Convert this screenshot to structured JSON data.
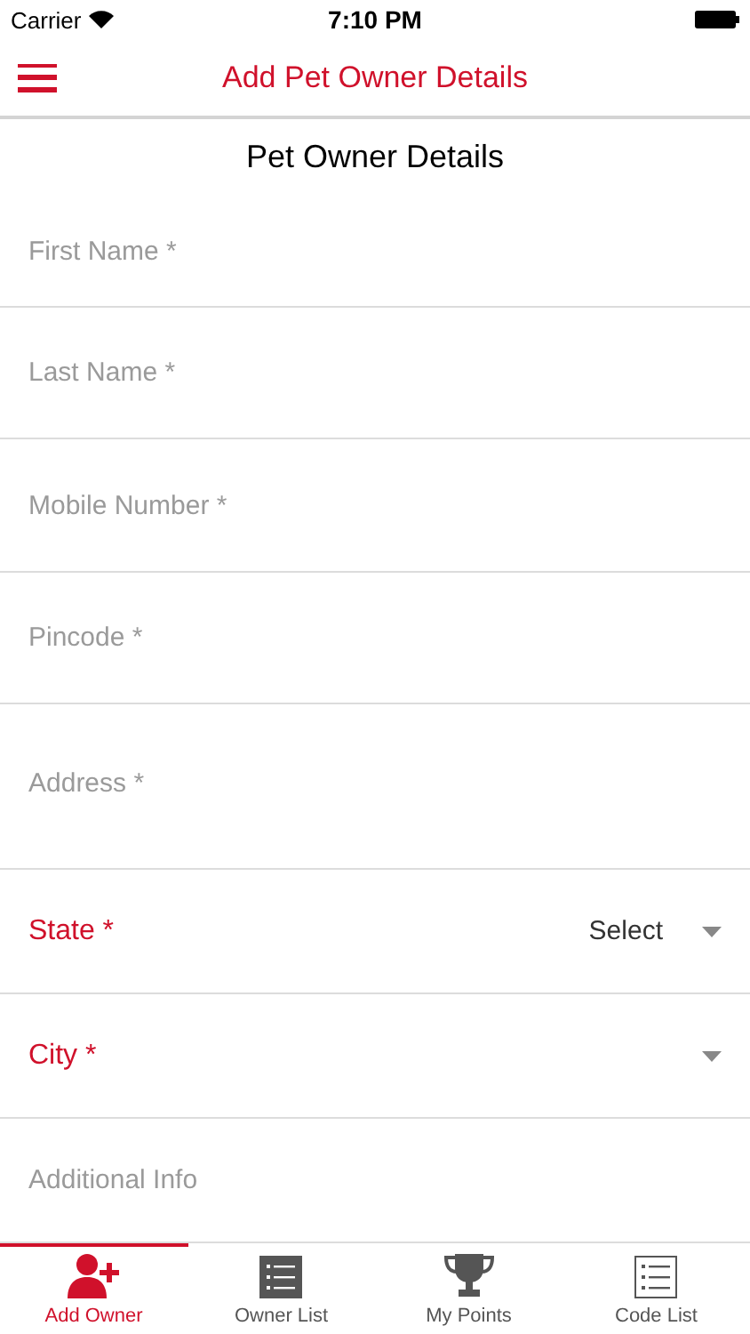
{
  "status_bar": {
    "carrier": "Carrier",
    "time": "7:10 PM"
  },
  "nav_bar": {
    "title": "Add Pet Owner Details"
  },
  "section_title": "Pet Owner Details",
  "fields": [
    {
      "kind": "text",
      "placeholder": "First Name *"
    },
    {
      "kind": "text",
      "placeholder": "Last Name *"
    },
    {
      "kind": "text",
      "placeholder": "Mobile Number *"
    },
    {
      "kind": "text",
      "placeholder": "Pincode *"
    },
    {
      "kind": "textarea",
      "placeholder": "Address *"
    },
    {
      "kind": "select",
      "label": "State *",
      "value": "Select"
    },
    {
      "kind": "select",
      "label": "City *"
    },
    {
      "kind": "text",
      "placeholder": "Additional Info"
    }
  ],
  "tabs": [
    {
      "label": "Add Owner",
      "selected": true
    },
    {
      "label": "Owner List",
      "selected": false
    },
    {
      "label": "My Points",
      "selected": false
    },
    {
      "label": "Code List",
      "selected": false
    }
  ]
}
